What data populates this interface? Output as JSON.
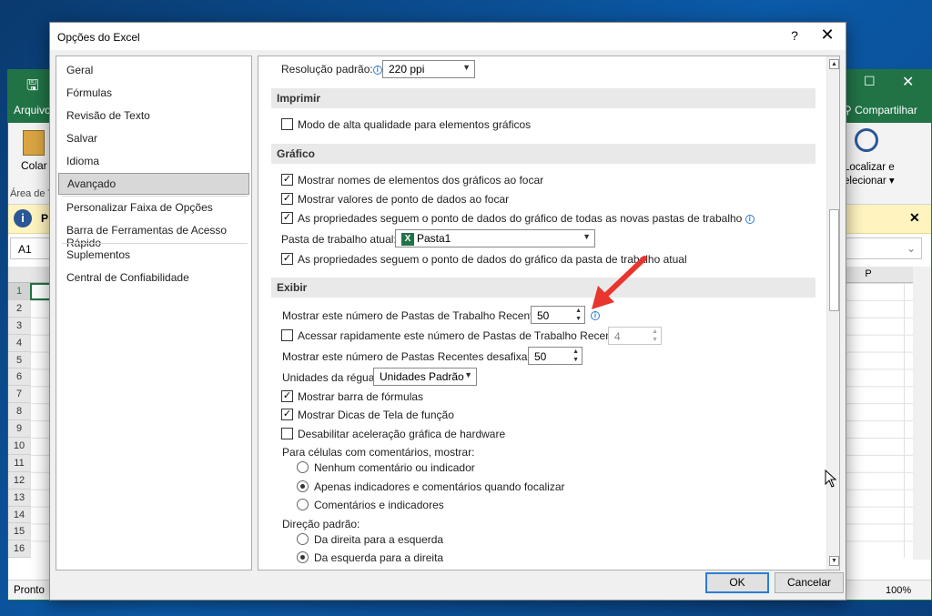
{
  "excel": {
    "arquivo": "Arquivo",
    "compartilhar": "Compartilhar",
    "colar": "Colar",
    "area": "Área de T",
    "localizar": "Localizar e",
    "selecionar": "elecionar ▾",
    "info_letter": "P",
    "namebox": "A1",
    "col_p": "P",
    "rows": [
      "1",
      "2",
      "3",
      "4",
      "5",
      "6",
      "7",
      "8",
      "9",
      "10",
      "11",
      "12",
      "13",
      "14",
      "15",
      "16"
    ],
    "status": "Pronto",
    "zoom": "100%"
  },
  "dialog": {
    "title": "Opções do Excel",
    "help": "?",
    "close": "✕",
    "nav": [
      "Geral",
      "Fórmulas",
      "Revisão de Texto",
      "Salvar",
      "Idioma",
      "Avançado",
      "Personalizar Faixa de Opções",
      "Barra de Ferramentas de Acesso Rápido",
      "Suplementos",
      "Central de Confiabilidade"
    ],
    "ok": "OK",
    "cancel": "Cancelar"
  },
  "content": {
    "resolucao_label": "Resolução padrão:",
    "resolucao_value": "220 ppi",
    "imprimir": "Imprimir",
    "modo_alta": "Modo de alta qualidade para elementos gráficos",
    "grafico": "Gráfico",
    "mostrar_nomes": "Mostrar nomes de elementos dos gráficos ao focar",
    "mostrar_valores": "Mostrar valores de ponto de dados  ao focar",
    "prop_novas": "As propriedades seguem o ponto de dados do gráfico de todas as novas pastas de trabalho",
    "pasta_atual_label": "Pasta de trabalho atual:",
    "pasta_atual_value": "Pasta1",
    "prop_atual": "As propriedades seguem o ponto de dados do gráfico da pasta de trabalho atual",
    "exibir": "Exibir",
    "mostrar_num_pastas": "Mostrar este número de Pastas de Trabalho Recentes:",
    "num_pastas_value": "50",
    "acessar_rapido": "Acessar rapidamente este número de Pastas de Trabalho Recentes:",
    "acessar_value": "4",
    "mostrar_desafixadas": "Mostrar este número de Pastas Recentes desafixadas:",
    "desafixadas_value": "50",
    "unidades_label": "Unidades da régua",
    "unidades_value": "Unidades Padrão",
    "barra_formulas": "Mostrar barra de fórmulas",
    "dicas_tela": "Mostrar Dicas de Tela de função",
    "desabilitar_acel": "Desabilitar aceleração gráfica de hardware",
    "celulas_coment": "Para células com comentários, mostrar:",
    "nenhum": "Nenhum comentário ou indicador",
    "apenas": "Apenas indicadores e comentários quando focalizar",
    "comentarios_ind": "Comentários e indicadores",
    "direcao": "Direção padrão:",
    "direita_esquerda": "Da direita para a esquerda",
    "esquerda_direita": "Da esquerda para a direita"
  },
  "colors": {
    "excel_green": "#217346",
    "arrow_red": "#e8352e",
    "info_blue": "#2b7cd3"
  }
}
